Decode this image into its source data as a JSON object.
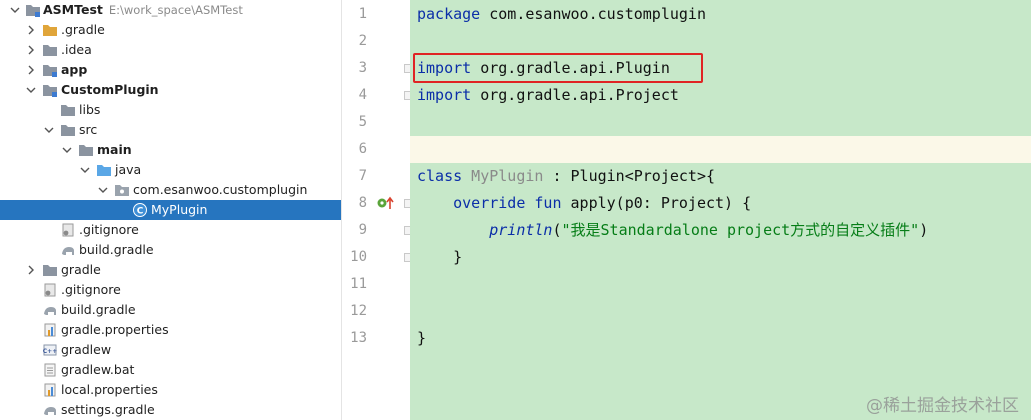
{
  "tree": {
    "items": [
      {
        "label": "ASMTest",
        "path": "E:\\work_space\\ASMTest",
        "icon": "module-folder-icon",
        "bold": true
      },
      {
        "label": ".gradle",
        "icon": "folder-orange-icon"
      },
      {
        "label": ".idea",
        "icon": "folder-icon"
      },
      {
        "label": "app",
        "icon": "module-folder-icon",
        "bold": true
      },
      {
        "label": "CustomPlugin",
        "icon": "module-folder-icon",
        "bold": true
      },
      {
        "label": "libs",
        "icon": "folder-icon"
      },
      {
        "label": "src",
        "icon": "folder-icon"
      },
      {
        "label": "main",
        "icon": "folder-icon",
        "bold": true
      },
      {
        "label": "java",
        "icon": "source-folder-icon"
      },
      {
        "label": "com.esanwoo.customplugin",
        "icon": "package-icon"
      },
      {
        "label": "MyPlugin",
        "icon": "kotlin-class-icon"
      },
      {
        "label": ".gitignore",
        "icon": "gitignore-file-icon"
      },
      {
        "label": "build.gradle",
        "icon": "gradle-file-icon"
      },
      {
        "label": "gradle",
        "icon": "folder-icon"
      },
      {
        "label": ".gitignore",
        "icon": "gitignore-file-icon"
      },
      {
        "label": "build.gradle",
        "icon": "gradle-file-icon"
      },
      {
        "label": "gradle.properties",
        "icon": "properties-file-icon"
      },
      {
        "label": "gradlew",
        "icon": "script-file-icon"
      },
      {
        "label": "gradlew.bat",
        "icon": "text-file-icon"
      },
      {
        "label": "local.properties",
        "icon": "properties-file-icon"
      },
      {
        "label": "settings.gradle",
        "icon": "gradle-file-icon"
      }
    ]
  },
  "editor": {
    "line_numbers": [
      "1",
      "2",
      "3",
      "4",
      "5",
      "6",
      "7",
      "8",
      "9",
      "10",
      "11",
      "12",
      "13"
    ],
    "lines": {
      "l1": {
        "kw": "package",
        "rest": " com.esanwoo.customplugin"
      },
      "l3": {
        "kw": "import",
        "rest": " org.gradle.api.Plugin"
      },
      "l4": {
        "kw": "import",
        "rest": " org.gradle.api.Project"
      },
      "l7": {
        "kw": "class",
        "name": " MyPlugin",
        "rest": " : Plugin<Project>{"
      },
      "l8": {
        "indent": "    ",
        "kw1": "override",
        "kw2": " fun",
        "rest": " apply(p0: Project) {"
      },
      "l9": {
        "indent": "        ",
        "fn": "println",
        "open": "(",
        "str": "\"我是Standardalone project方式的自定义插件\"",
        "close": ")"
      },
      "l10": {
        "text": "    }"
      },
      "l13": {
        "text": "}"
      }
    }
  },
  "watermark": "@稀土掘金技术社区",
  "colors": {
    "editor_bg": "#c7e8c9",
    "selection": "#2675bf",
    "keyword": "#0b2ea8",
    "string": "#067d17",
    "highlight_box": "#e02424"
  }
}
